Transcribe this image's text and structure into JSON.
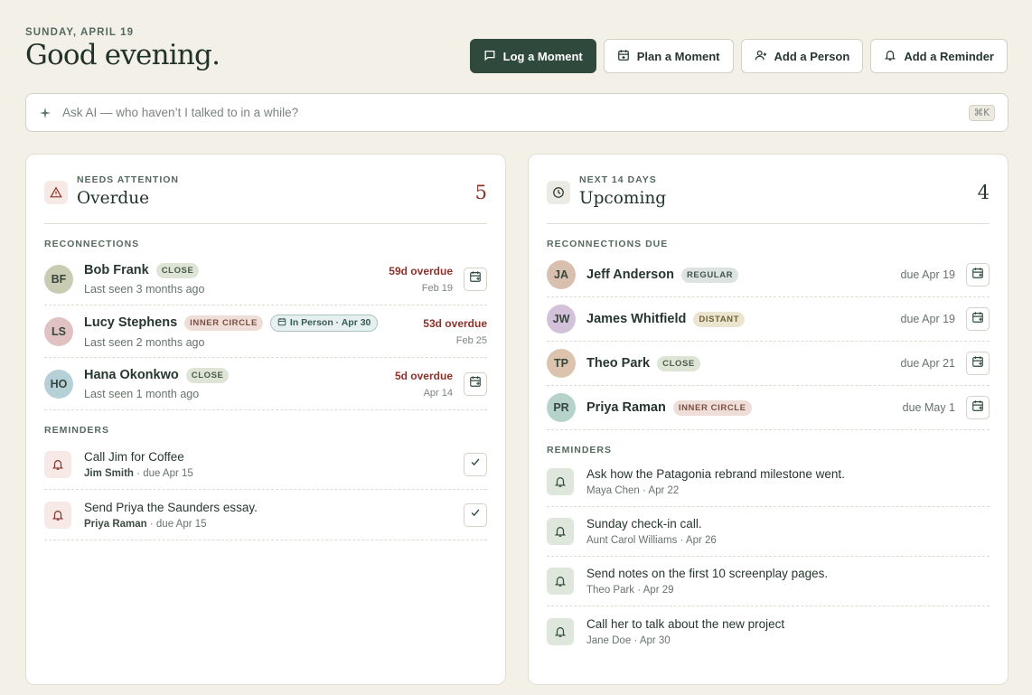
{
  "header": {
    "date": "SUNDAY, APRIL 19",
    "greeting": "Good evening.",
    "buttons": [
      {
        "label": "Log a Moment",
        "icon": "message-square-icon"
      },
      {
        "label": "Plan a Moment",
        "icon": "calendar-plus-icon"
      },
      {
        "label": "Add a Person",
        "icon": "user-plus-icon"
      },
      {
        "label": "Add a Reminder",
        "icon": "bell-icon"
      }
    ]
  },
  "ask": {
    "placeholder": "Ask AI — who haven’t I talked to in a while?",
    "shortcut": "⌘K"
  },
  "overdue": {
    "kicker": "NEEDS ATTENTION",
    "title": "Overdue",
    "count": "5",
    "section_reconnections": "RECONNECTIONS",
    "people": [
      {
        "initials": "BF",
        "name": "Bob Frank",
        "tag": "CLOSE",
        "last_seen": "Last seen 3 months ago",
        "overdue": "59d overdue",
        "date": "Feb 19"
      },
      {
        "initials": "LS",
        "name": "Lucy Stephens",
        "tag": "INNER CIRCLE",
        "chip": "In Person · Apr 30",
        "last_seen": "Last seen 2 months ago",
        "overdue": "53d overdue",
        "date": "Feb 25"
      },
      {
        "initials": "HO",
        "name": "Hana Okonkwo",
        "tag": "CLOSE",
        "last_seen": "Last seen 1 month ago",
        "overdue": "5d overdue",
        "date": "Apr 14"
      }
    ],
    "section_reminders": "REMINDERS",
    "reminders": [
      {
        "title": "Call Jim for Coffee",
        "person": "Jim Smith",
        "due": " · due Apr 15"
      },
      {
        "title": "Send Priya the Saunders essay.",
        "person": "Priya Raman",
        "due": " · due Apr 15"
      }
    ]
  },
  "upcoming": {
    "kicker": "NEXT 14 DAYS",
    "title": "Upcoming",
    "count": "4",
    "section_reconnections": "RECONNECTIONS DUE",
    "people": [
      {
        "initials": "JA",
        "name": "Jeff Anderson",
        "tag": "REGULAR",
        "due": "due Apr 19"
      },
      {
        "initials": "JW",
        "name": "James Whitfield",
        "tag": "DISTANT",
        "due": "due Apr 19"
      },
      {
        "initials": "TP",
        "name": "Theo Park",
        "tag": "CLOSE",
        "due": "due Apr 21"
      },
      {
        "initials": "PR",
        "name": "Priya Raman",
        "tag": "INNER CIRCLE",
        "due": "due May 1"
      }
    ],
    "section_reminders": "REMINDERS",
    "reminders": [
      {
        "title": "Ask how the Patagonia rebrand milestone went.",
        "meta": "Maya Chen · Apr 22"
      },
      {
        "title": "Sunday check-in call.",
        "meta": "Aunt Carol Williams · Apr 26"
      },
      {
        "title": "Send notes on the first 10 screenplay pages.",
        "meta": "Theo Park · Apr 29"
      },
      {
        "title": "Call her to talk about the new project",
        "meta": "Jane Doe · Apr 30"
      }
    ]
  },
  "colors": {
    "accent": "#2f4a3d",
    "overdue": "#8d3229",
    "background": "#f3f0e8"
  }
}
